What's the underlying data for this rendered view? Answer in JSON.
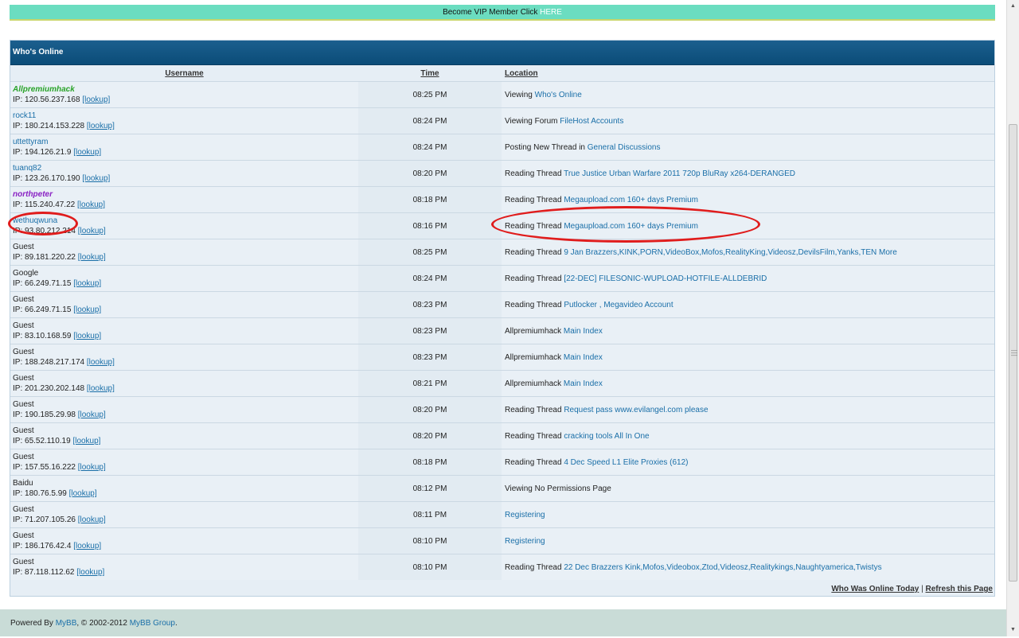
{
  "vip": {
    "text": "Become VIP Member Click ",
    "link": "HERE"
  },
  "panel": {
    "title": "Who's Online"
  },
  "columns": {
    "username": "Username",
    "time": "Time",
    "location": "Location"
  },
  "lookup_label": "[lookup]",
  "rows": [
    {
      "user": "Allpremiumhack",
      "style": "green",
      "ip": "IP: 120.56.237.168",
      "time": "08:25 PM",
      "action": "Viewing ",
      "target": "Who's Online"
    },
    {
      "user": "rock11",
      "style": "link",
      "ip": "IP: 180.214.153.228",
      "time": "08:24 PM",
      "action": "Viewing Forum ",
      "target": "FileHost Accounts"
    },
    {
      "user": "uttettyram",
      "style": "link",
      "ip": "IP: 194.126.21.9",
      "time": "08:24 PM",
      "action": "Posting New Thread in ",
      "target": "General Discussions"
    },
    {
      "user": "tuanq82",
      "style": "link",
      "ip": "IP: 123.26.170.190",
      "time": "08:20 PM",
      "action": "Reading Thread ",
      "target": "True Justice Urban Warfare 2011 720p BluRay x264-DERANGED"
    },
    {
      "user": "northpeter",
      "style": "purple",
      "ip": "IP: 115.240.47.22",
      "time": "08:18 PM",
      "action": "Reading Thread ",
      "target": "Megaupload.com 160+ days Premium"
    },
    {
      "user": "wethuqwuna",
      "style": "link",
      "ip": "IP: 93.80.212.214",
      "time": "08:16 PM",
      "action": "Reading Thread ",
      "target": "Megaupload.com 160+ days Premium"
    },
    {
      "user": "Guest",
      "style": "plain",
      "ip": "IP: 89.181.220.22",
      "time": "08:25 PM",
      "action": "Reading Thread ",
      "target": "9 Jan Brazzers,KINK,PORN,VideoBox,Mofos,RealityKing,Videosz,DevilsFilm,Yanks,TEN More"
    },
    {
      "user": "Google",
      "style": "plain",
      "ip": "IP: 66.249.71.15",
      "time": "08:24 PM",
      "action": "Reading Thread ",
      "target": "[22-DEC] FILESONIC-WUPLOAD-HOTFILE-ALLDEBRID"
    },
    {
      "user": "Guest",
      "style": "plain",
      "ip": "IP: 66.249.71.15",
      "time": "08:23 PM",
      "action": "Reading Thread ",
      "target": "Putlocker , Megavideo Account"
    },
    {
      "user": "Guest",
      "style": "plain",
      "ip": "IP: 83.10.168.59",
      "time": "08:23 PM",
      "action": "Allpremiumhack ",
      "target": "Main Index"
    },
    {
      "user": "Guest",
      "style": "plain",
      "ip": "IP: 188.248.217.174",
      "time": "08:23 PM",
      "action": "Allpremiumhack ",
      "target": "Main Index"
    },
    {
      "user": "Guest",
      "style": "plain",
      "ip": "IP: 201.230.202.148",
      "time": "08:21 PM",
      "action": "Allpremiumhack ",
      "target": "Main Index"
    },
    {
      "user": "Guest",
      "style": "plain",
      "ip": "IP: 190.185.29.98",
      "time": "08:20 PM",
      "action": "Reading Thread ",
      "target": "Request pass www.evilangel.com please"
    },
    {
      "user": "Guest",
      "style": "plain",
      "ip": "IP: 65.52.110.19",
      "time": "08:20 PM",
      "action": "Reading Thread ",
      "target": "cracking tools All In One"
    },
    {
      "user": "Guest",
      "style": "plain",
      "ip": "IP: 157.55.16.222",
      "time": "08:18 PM",
      "action": "Reading Thread ",
      "target": "4 Dec Speed L1 Elite Proxies (612)"
    },
    {
      "user": "Baidu",
      "style": "plain",
      "ip": "IP: 180.76.5.99",
      "time": "08:12 PM",
      "action": "Viewing No Permissions Page",
      "target": ""
    },
    {
      "user": "Guest",
      "style": "plain",
      "ip": "IP: 71.207.105.26",
      "time": "08:11 PM",
      "action": "",
      "target": "Registering"
    },
    {
      "user": "Guest",
      "style": "plain",
      "ip": "IP: 186.176.42.4",
      "time": "08:10 PM",
      "action": "",
      "target": "Registering"
    },
    {
      "user": "Guest",
      "style": "plain",
      "ip": "IP: 87.118.112.62",
      "time": "08:10 PM",
      "action": "Reading Thread ",
      "target": "22 Dec Brazzers Kink,Mofos,Videobox,Ztod,Videosz,Realitykings,Naughtyamerica,Twistys"
    }
  ],
  "footer_links": {
    "who_was_online": "Who Was Online Today",
    "separator": "|",
    "refresh": "Refresh this Page"
  },
  "footer": {
    "prefix": "Powered By ",
    "mybb": "MyBB",
    "middle": ", © 2002-2012 ",
    "group": "MyBB Group",
    "suffix": "."
  },
  "colors": {
    "header": "#0b4c78",
    "vip_bar": "#6bddc0",
    "link": "#1a6fa8",
    "annotation": "#e01c1c"
  }
}
